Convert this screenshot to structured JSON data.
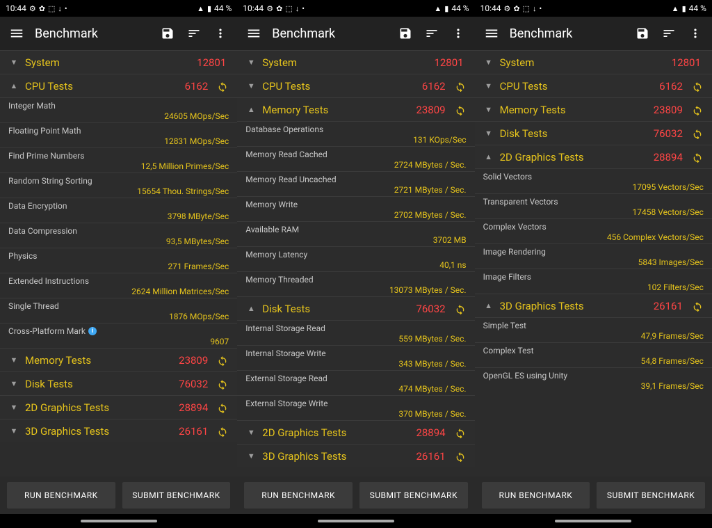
{
  "status": {
    "time": "10:44",
    "battery": "44 %"
  },
  "toolbar": {
    "title": "Benchmark"
  },
  "buttons": {
    "run": "RUN BENCHMARK",
    "submit": "SUBMIT BENCHMARK"
  },
  "categories": {
    "system": {
      "label": "System",
      "score": "12801"
    },
    "cpu": {
      "label": "CPU Tests",
      "score": "6162"
    },
    "memory": {
      "label": "Memory Tests",
      "score": "23809"
    },
    "disk": {
      "label": "Disk Tests",
      "score": "76032"
    },
    "gfx2d": {
      "label": "2D Graphics Tests",
      "score": "28894"
    },
    "gfx3d": {
      "label": "3D Graphics Tests",
      "score": "26161"
    }
  },
  "cpu_items": [
    {
      "label": "Integer Math",
      "value": "24605 MOps/Sec"
    },
    {
      "label": "Floating Point Math",
      "value": "12831 MOps/Sec"
    },
    {
      "label": "Find Prime Numbers",
      "value": "12,5 Million Primes/Sec"
    },
    {
      "label": "Random String Sorting",
      "value": "15654 Thou. Strings/Sec"
    },
    {
      "label": "Data Encryption",
      "value": "3798 MByte/Sec"
    },
    {
      "label": "Data Compression",
      "value": "93,5 MBytes/Sec"
    },
    {
      "label": "Physics",
      "value": "271 Frames/Sec"
    },
    {
      "label": "Extended Instructions",
      "value": "2624 Million Matrices/Sec"
    },
    {
      "label": "Single Thread",
      "value": "1876 MOps/Sec"
    },
    {
      "label": "Cross-Platform Mark",
      "value": "9607",
      "info": true
    }
  ],
  "memory_items": [
    {
      "label": "Database Operations",
      "value": "131 KOps/Sec"
    },
    {
      "label": "Memory Read Cached",
      "value": "2724 MBytes / Sec."
    },
    {
      "label": "Memory Read Uncached",
      "value": "2721 MBytes / Sec."
    },
    {
      "label": "Memory Write",
      "value": "2702 MBytes / Sec."
    },
    {
      "label": "Available RAM",
      "value": "3702 MB"
    },
    {
      "label": "Memory Latency",
      "value": "40,1 ns"
    },
    {
      "label": "Memory Threaded",
      "value": "13073 MBytes / Sec."
    }
  ],
  "disk_items": [
    {
      "label": "Internal Storage Read",
      "value": "559 MBytes / Sec."
    },
    {
      "label": "Internal Storage Write",
      "value": "343 MBytes / Sec."
    },
    {
      "label": "External Storage Read",
      "value": "474 MBytes / Sec."
    },
    {
      "label": "External Storage Write",
      "value": "370 MBytes / Sec."
    }
  ],
  "gfx2d_items": [
    {
      "label": "Solid Vectors",
      "value": "17095 Vectors/Sec"
    },
    {
      "label": "Transparent Vectors",
      "value": "17458 Vectors/Sec"
    },
    {
      "label": "Complex Vectors",
      "value": "456 Complex Vectors/Sec"
    },
    {
      "label": "Image Rendering",
      "value": "5843 Images/Sec"
    },
    {
      "label": "Image Filters",
      "value": "102 Filters/Sec"
    }
  ],
  "gfx3d_items": [
    {
      "label": "Simple Test",
      "value": "47,9 Frames/Sec"
    },
    {
      "label": "Complex Test",
      "value": "54,8 Frames/Sec"
    },
    {
      "label": "OpenGL ES using Unity",
      "value": "39,1 Frames/Sec"
    }
  ],
  "columns": [
    {
      "rows": [
        {
          "kind": "cat",
          "key": "system",
          "expanded": false,
          "retry": false
        },
        {
          "kind": "cat",
          "key": "cpu",
          "expanded": true,
          "retry": true
        },
        {
          "kind": "items",
          "items": "cpu_items"
        },
        {
          "kind": "cat",
          "key": "memory",
          "expanded": false,
          "retry": true
        },
        {
          "kind": "cat",
          "key": "disk",
          "expanded": false,
          "retry": true
        },
        {
          "kind": "cat",
          "key": "gfx2d",
          "expanded": false,
          "retry": true
        },
        {
          "kind": "cat",
          "key": "gfx3d",
          "expanded": false,
          "retry": true
        }
      ]
    },
    {
      "rows": [
        {
          "kind": "cat",
          "key": "system",
          "expanded": false,
          "retry": false
        },
        {
          "kind": "cat",
          "key": "cpu",
          "expanded": false,
          "retry": true
        },
        {
          "kind": "cat",
          "key": "memory",
          "expanded": true,
          "retry": true
        },
        {
          "kind": "items",
          "items": "memory_items"
        },
        {
          "kind": "cat",
          "key": "disk",
          "expanded": true,
          "retry": true
        },
        {
          "kind": "items",
          "items": "disk_items"
        },
        {
          "kind": "cat",
          "key": "gfx2d",
          "expanded": false,
          "retry": true
        },
        {
          "kind": "cat",
          "key": "gfx3d",
          "expanded": false,
          "retry": true
        }
      ]
    },
    {
      "rows": [
        {
          "kind": "cat",
          "key": "system",
          "expanded": false,
          "retry": false
        },
        {
          "kind": "cat",
          "key": "cpu",
          "expanded": false,
          "retry": true
        },
        {
          "kind": "cat",
          "key": "memory",
          "expanded": false,
          "retry": true
        },
        {
          "kind": "cat",
          "key": "disk",
          "expanded": false,
          "retry": true
        },
        {
          "kind": "cat",
          "key": "gfx2d",
          "expanded": true,
          "retry": true
        },
        {
          "kind": "items",
          "items": "gfx2d_items"
        },
        {
          "kind": "cat",
          "key": "gfx3d",
          "expanded": true,
          "retry": true
        },
        {
          "kind": "items",
          "items": "gfx3d_items"
        }
      ]
    }
  ]
}
